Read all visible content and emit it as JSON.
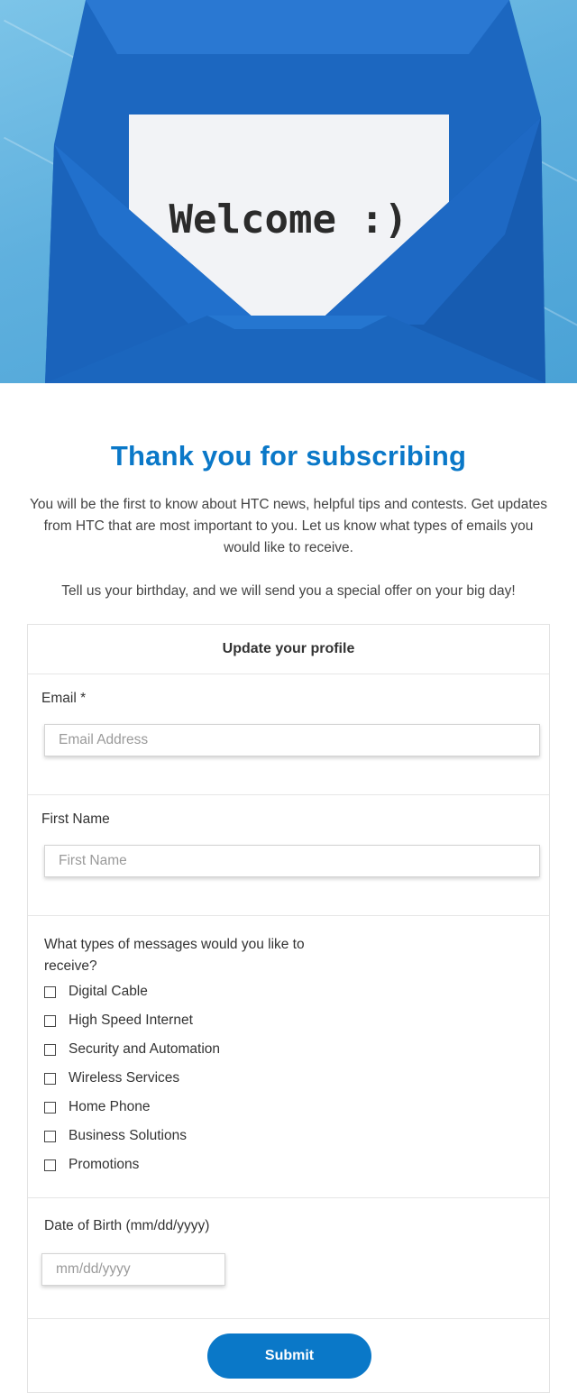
{
  "hero": {
    "card_text": "Welcome :)"
  },
  "title": "Thank you for subscribing",
  "intro": "You will be the first to know about HTC news, helpful tips and contests. Get updates from HTC that are most important to you. Let us know what types of emails you would like to receive.",
  "birthday_note": "Tell us your birthday, and we will send you a special offer on your big day!",
  "form": {
    "heading": "Update your profile",
    "email": {
      "label": "Email *",
      "placeholder": "Email Address"
    },
    "first_name": {
      "label": "First Name",
      "placeholder": "First Name"
    },
    "messages": {
      "question": "What types of messages would you like to receive?",
      "options": [
        {
          "label": "Digital Cable",
          "checked": false
        },
        {
          "label": "High Speed Internet",
          "checked": false
        },
        {
          "label": "Security and Automation",
          "checked": false
        },
        {
          "label": "Wireless Services",
          "checked": false
        },
        {
          "label": "Home Phone",
          "checked": false
        },
        {
          "label": "Business Solutions",
          "checked": false
        },
        {
          "label": "Promotions",
          "checked": false
        }
      ]
    },
    "dob": {
      "label": "Date of Birth (mm/dd/yyyy)",
      "placeholder": "mm/dd/yyyy"
    },
    "submit_label": "Submit"
  },
  "colors": {
    "accent": "#0a78c8",
    "envelope": "#1f6fc9"
  }
}
